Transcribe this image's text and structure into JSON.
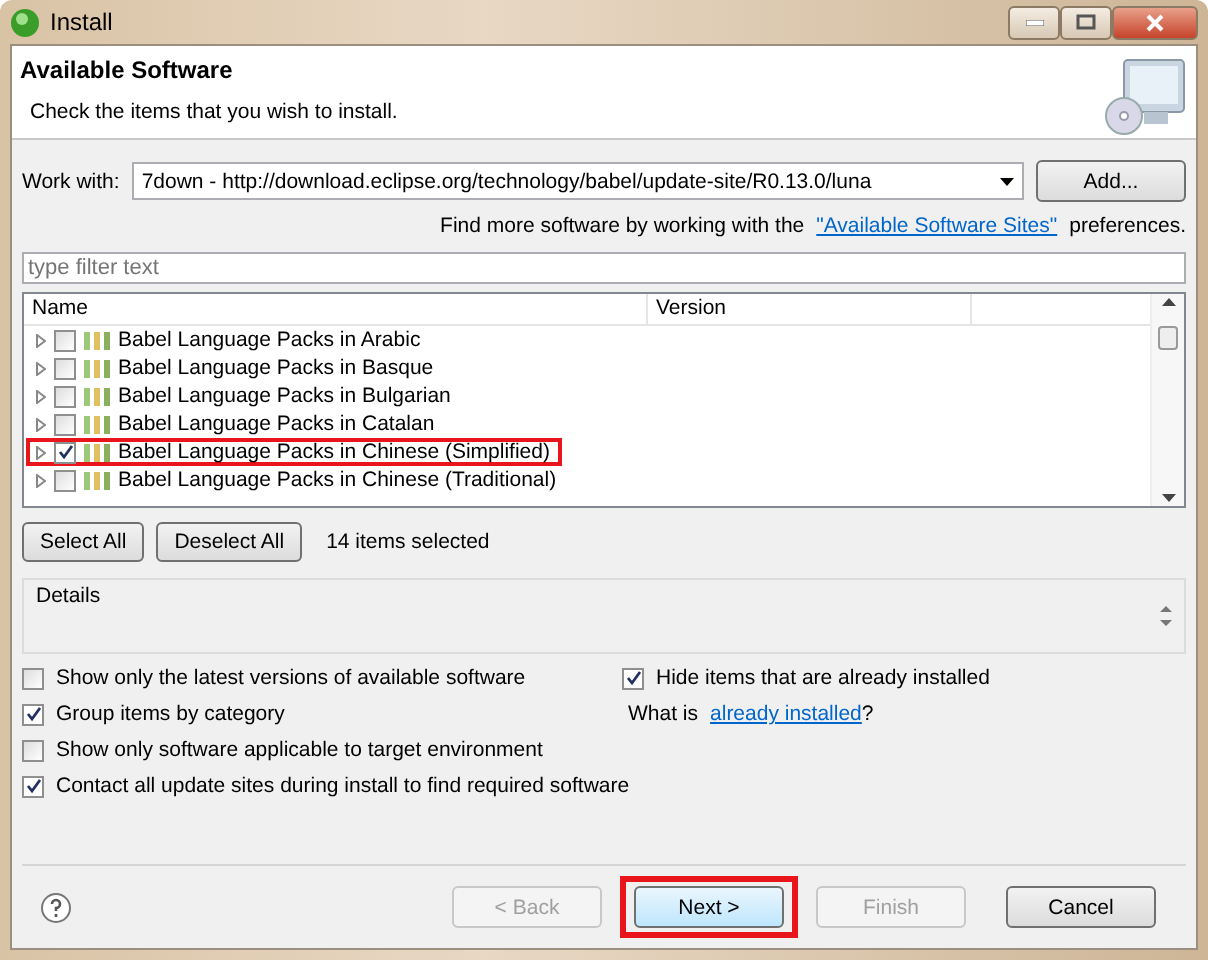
{
  "window": {
    "title": "Install"
  },
  "header": {
    "title": "Available Software",
    "subtitle": "Check the items that you wish to install."
  },
  "work_with": {
    "label": "Work with:",
    "value": "7down - http://download.eclipse.org/technology/babel/update-site/R0.13.0/luna",
    "add_button": "Add..."
  },
  "sites_note": {
    "before": "Find more software by working with the",
    "link": "\"Available Software Sites\"",
    "after": "preferences."
  },
  "filter": {
    "placeholder": "type filter text"
  },
  "tree": {
    "columns": [
      "Name",
      "Version"
    ],
    "rows": [
      {
        "label": "Babel Language Packs in Arabic",
        "checked": false,
        "highlighted": false
      },
      {
        "label": "Babel Language Packs in Basque",
        "checked": false,
        "highlighted": false
      },
      {
        "label": "Babel Language Packs in Bulgarian",
        "checked": false,
        "highlighted": false
      },
      {
        "label": "Babel Language Packs in Catalan",
        "checked": false,
        "highlighted": false
      },
      {
        "label": "Babel Language Packs in Chinese (Simplified)",
        "checked": true,
        "highlighted": true
      },
      {
        "label": "Babel Language Packs in Chinese (Traditional)",
        "checked": false,
        "highlighted": false
      }
    ]
  },
  "selection": {
    "buttons": [
      "Select All",
      "Deselect All"
    ],
    "status": "14 items selected"
  },
  "details": {
    "title": "Details"
  },
  "options_left": [
    {
      "label": "Show only the latest versions of available software",
      "checked": false
    },
    {
      "label": "Group items by category",
      "checked": true
    },
    {
      "label": "Show only software applicable to target environment",
      "checked": false
    },
    {
      "label": "Contact all update sites during install to find required software",
      "checked": true
    }
  ],
  "options_right": {
    "hide": {
      "label": "Hide items that are already installed",
      "checked": true
    },
    "what_is": "What is",
    "link": "already installed",
    "after": "?"
  },
  "footer": {
    "buttons": [
      {
        "label": "< Back",
        "disabled": true,
        "highlighted": false
      },
      {
        "label": "Next >",
        "disabled": false,
        "highlighted": true
      },
      {
        "label": "Finish",
        "disabled": true,
        "highlighted": false
      },
      {
        "label": "Cancel",
        "disabled": false,
        "highlighted": false
      }
    ]
  }
}
